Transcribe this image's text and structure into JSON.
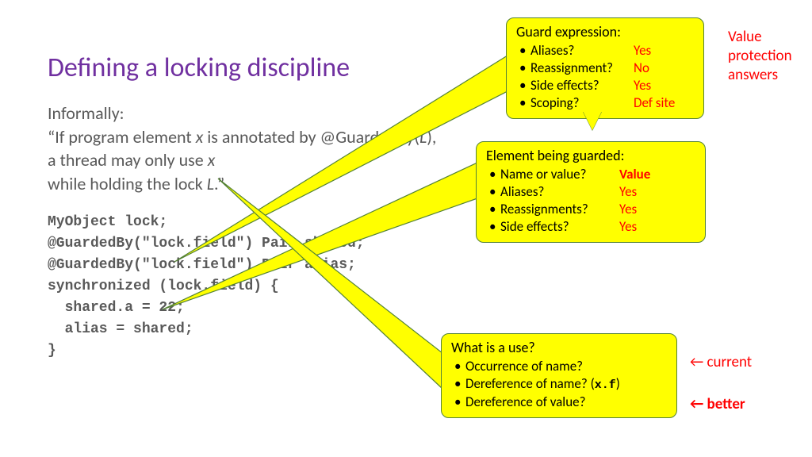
{
  "title": "Defining a locking discipline",
  "body": {
    "line1": "Informally:",
    "line2a": "“If program element ",
    "line2x": "x",
    "line2b": " is annotated by @GuardedBy(",
    "line2L": "L",
    "line2c": "),",
    "line3a": "a thread may only use ",
    "line3x": "x",
    "line4a": "while holding the lock ",
    "line4L": "L",
    "line4b": ".”"
  },
  "code": {
    "l1": "MyObject lock;",
    "l2": "@GuardedBy(\"lock.field\") Pair shared;",
    "l3": "@GuardedBy(\"lock.field\") Pair alias;",
    "l4": "",
    "l5": "synchronized (lock.field) {",
    "l6": "  shared.a = 22;",
    "l7": "  alias = shared;",
    "l8": "}"
  },
  "callout1": {
    "header": "Guard expression:",
    "items": [
      {
        "label": "Aliases?",
        "ans": "Yes"
      },
      {
        "label": "Reassignment?",
        "ans": "No"
      },
      {
        "label": "Side effects?",
        "ans": "Yes"
      },
      {
        "label": "Scoping?",
        "ans": "Def site"
      }
    ]
  },
  "callout2": {
    "header": "Element being guarded:",
    "items": [
      {
        "label": "Name or value?",
        "ans": "Value",
        "bold": true
      },
      {
        "label": "Aliases?",
        "ans": "Yes"
      },
      {
        "label": "Reassignments?",
        "ans": "Yes"
      },
      {
        "label": "Side effects?",
        "ans": "Yes"
      }
    ]
  },
  "callout3": {
    "header": "What is a use?",
    "items": [
      {
        "label": "Occurrence of name?"
      },
      {
        "label": "Dereference of name? (",
        "mono": "x.f",
        "after": ")"
      },
      {
        "label": "Dereference of value?"
      }
    ]
  },
  "sidenote1": "Value protection answers",
  "sidenote2": "← current",
  "sidenote3": "← better"
}
